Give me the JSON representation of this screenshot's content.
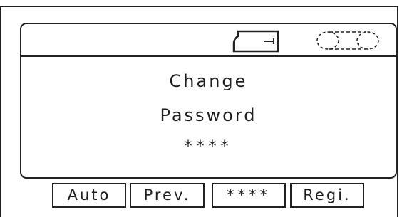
{
  "screen": {
    "status_icons": [
      "battery-icon",
      "signal-icon"
    ],
    "lines": [
      "Change",
      "Password",
      "****"
    ]
  },
  "softkeys": [
    {
      "label": "Auto"
    },
    {
      "label": "Prev."
    },
    {
      "label": "****"
    },
    {
      "label": "Regi."
    }
  ]
}
